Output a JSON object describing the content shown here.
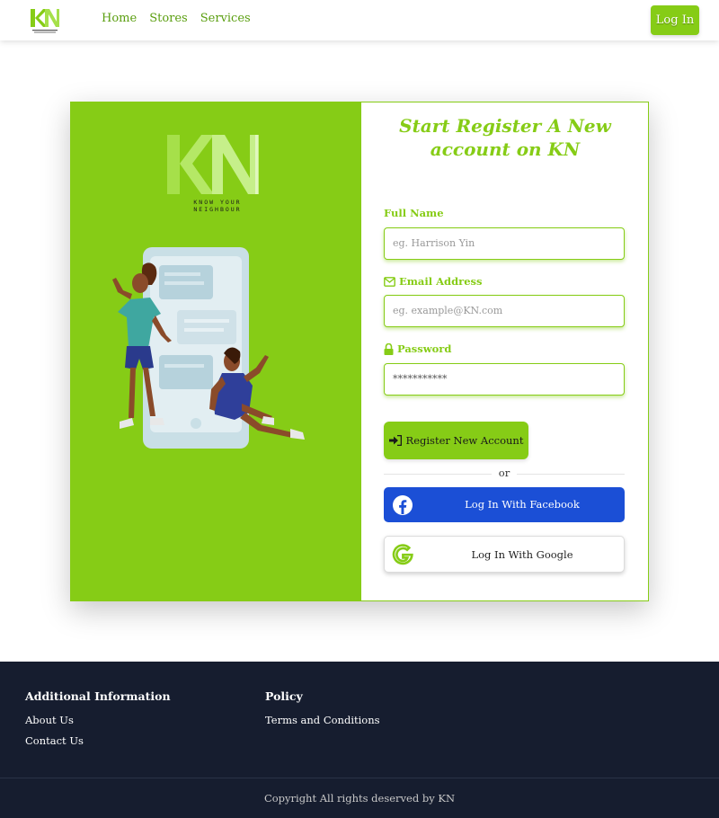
{
  "brand": {
    "logo_text": "KN",
    "logo_tagline": "KNOW YOUR NEIGHBOUR",
    "accent_color": "#86cc16"
  },
  "nav": {
    "links": [
      "Home",
      "Stores",
      "Services"
    ],
    "login_label": "Log In"
  },
  "register": {
    "title": "Start Register A New account on KN",
    "full_name_label": "Full Name",
    "full_name_placeholder": "eg. Harrison Yin",
    "email_label": "Email Address",
    "email_placeholder": "eg. example@KN.com",
    "password_label": "Password",
    "password_value": "***********",
    "register_button": "Register New Account",
    "or_text": "or",
    "facebook_button": "Log In With Facebook",
    "google_button": "Log In With Google"
  },
  "footer": {
    "col1_title": "Additional Information",
    "col1_links": [
      "About Us",
      "Contact Us"
    ],
    "col2_title": "Policy",
    "col2_links": [
      "Terms and Conditions"
    ],
    "copyright": "Copyright All rights deserved by KN"
  }
}
